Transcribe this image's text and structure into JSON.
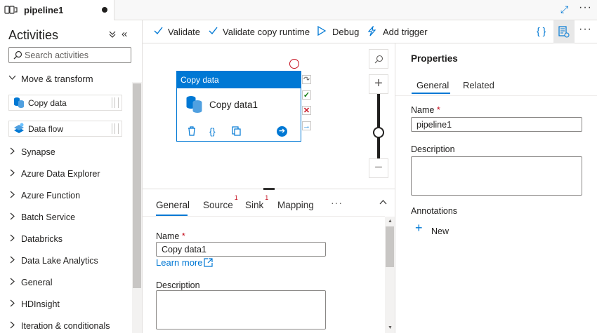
{
  "tab": {
    "title": "pipeline1",
    "icon": "pipeline-icon",
    "unsaved_icon": "unsaved-dot-icon"
  },
  "window": {
    "expand_icon": "expand-icon",
    "more_icon": "more-icon"
  },
  "activities": {
    "title": "Activities",
    "search_placeholder": "Search activities",
    "categories": [
      {
        "label": "Move & transform",
        "expanded": true,
        "items": [
          {
            "label": "Copy data",
            "icon": "copy-data-icon"
          },
          {
            "label": "Data flow",
            "icon": "data-flow-icon"
          }
        ]
      },
      {
        "label": "Synapse"
      },
      {
        "label": "Azure Data Explorer"
      },
      {
        "label": "Azure Function"
      },
      {
        "label": "Batch Service"
      },
      {
        "label": "Databricks"
      },
      {
        "label": "Data Lake Analytics"
      },
      {
        "label": "General"
      },
      {
        "label": "HDInsight"
      },
      {
        "label": "Iteration & conditionals"
      }
    ]
  },
  "toolbar": {
    "validate": "Validate",
    "validate_runtime": "Validate copy runtime",
    "debug": "Debug",
    "add_trigger": "Add trigger"
  },
  "canvas": {
    "activity": {
      "type_label": "Copy data",
      "name": "Copy data1"
    }
  },
  "bottom_panel": {
    "tabs": [
      {
        "label": "General",
        "active": true
      },
      {
        "label": "Source",
        "badge": "1"
      },
      {
        "label": "Sink",
        "badge": "1"
      },
      {
        "label": "Mapping"
      }
    ],
    "name_label": "Name",
    "required_mark": "*",
    "name_value": "Copy data1",
    "learn_more": "Learn more",
    "description_label": "Description"
  },
  "properties": {
    "title": "Properties",
    "tabs": [
      "General",
      "Related"
    ],
    "name_label": "Name",
    "required_mark": "*",
    "name_value": "pipeline1",
    "description_label": "Description",
    "annotations_label": "Annotations",
    "new_label": "New"
  },
  "colors": {
    "accent": "#0078d4",
    "error": "#c50f1f",
    "success": "#107c10"
  }
}
